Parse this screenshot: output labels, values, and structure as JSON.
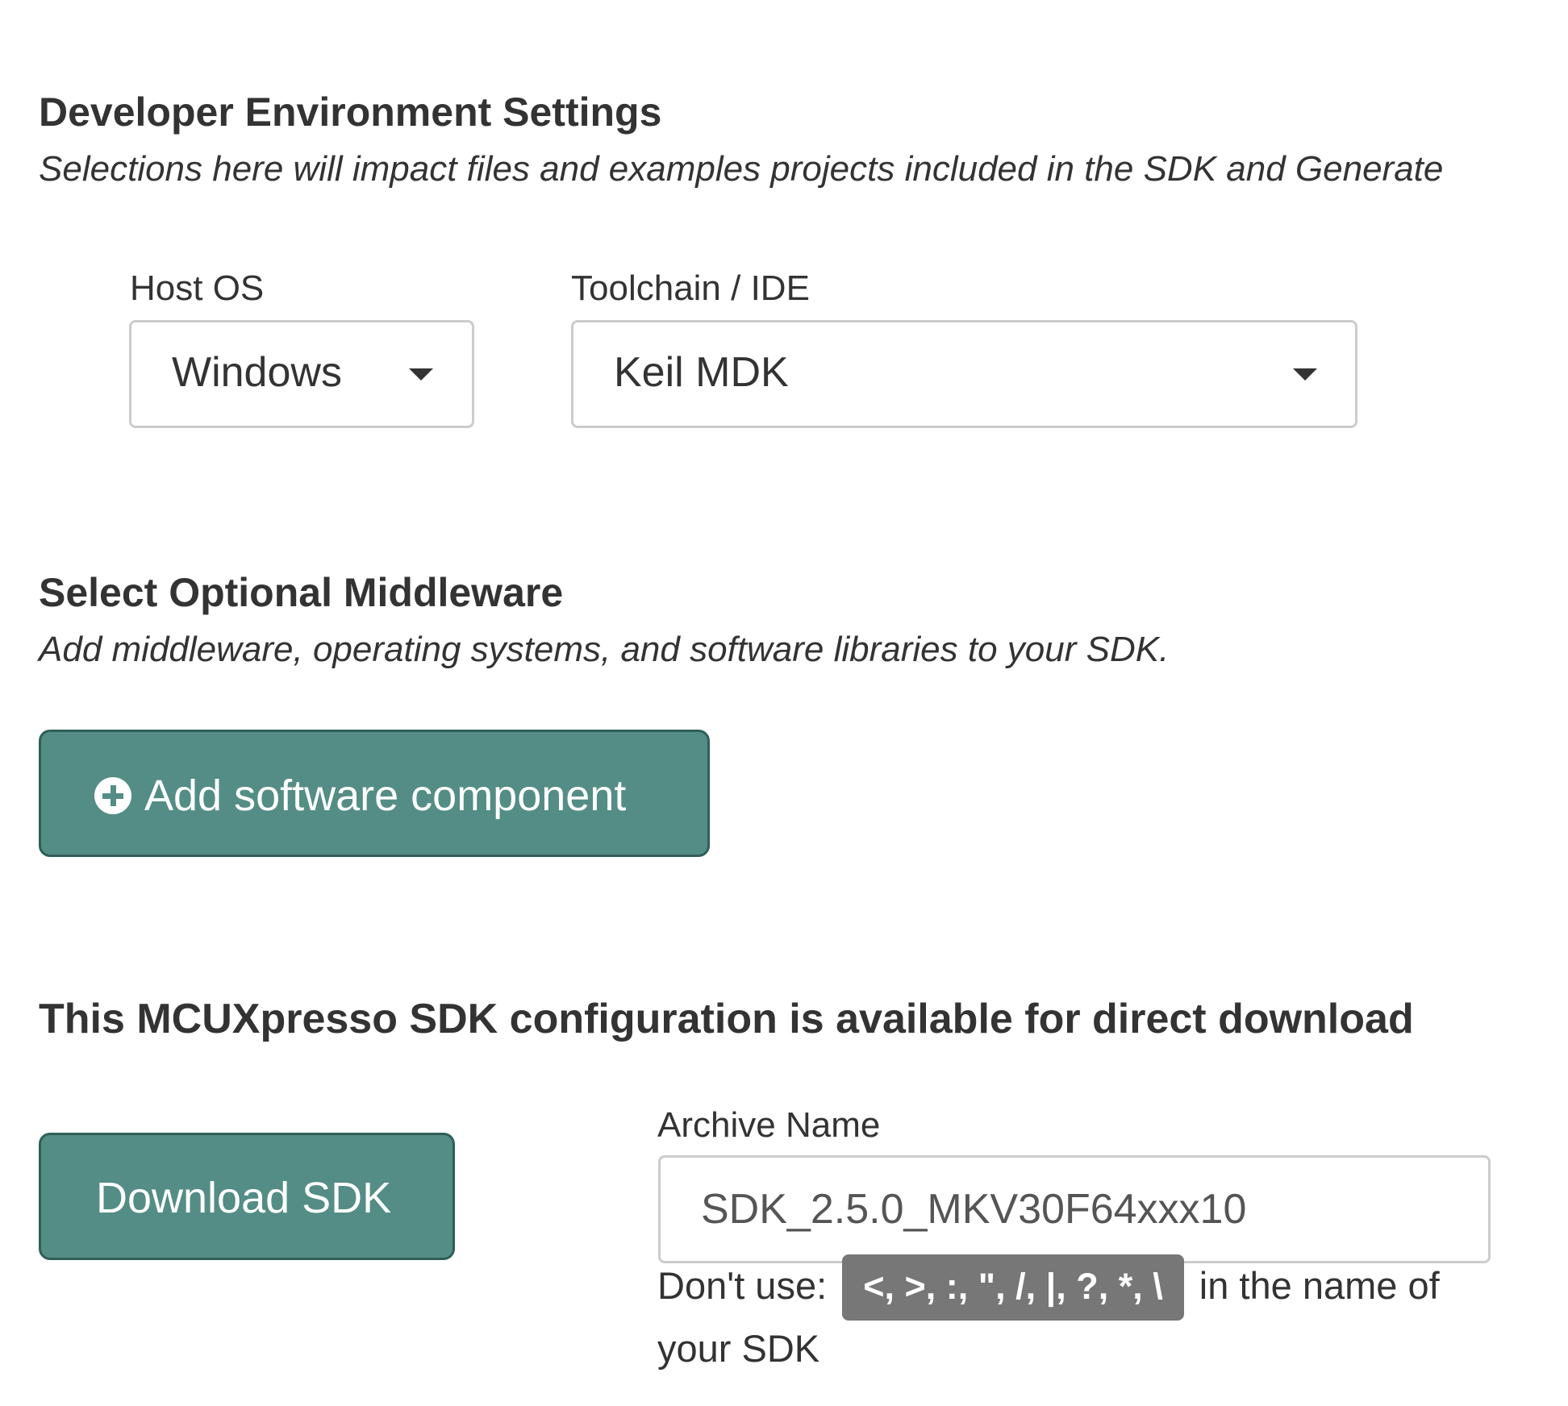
{
  "environment": {
    "title": "Developer Environment Settings",
    "subtitle": "Selections here will impact files and examples projects included in the SDK and Generate",
    "host_os": {
      "label": "Host OS",
      "value": "Windows"
    },
    "toolchain": {
      "label": "Toolchain / IDE",
      "value": "Keil MDK"
    }
  },
  "middleware": {
    "title": "Select Optional Middleware",
    "subtitle": "Add middleware, operating systems, and software libraries to your SDK.",
    "add_button_label": "Add software component"
  },
  "download": {
    "title": "This MCUXpresso SDK configuration is available for direct download",
    "button_label": "Download SDK",
    "archive_label": "Archive Name",
    "archive_value": "SDK_2.5.0_MKV30F64xxx10",
    "warning_prefix": "Don't use:",
    "forbidden_chars": "<, >, :, \", /, |, ?, *, \\",
    "warning_suffix": "in the name of your SDK"
  },
  "colors": {
    "primary_button": "#548d85",
    "primary_button_border": "#2f5f59",
    "badge": "#777777",
    "input_border": "#cccccc"
  },
  "icons": {
    "add_button_icon": "plus-circle-icon",
    "select_caret": "caret-down-icon"
  }
}
